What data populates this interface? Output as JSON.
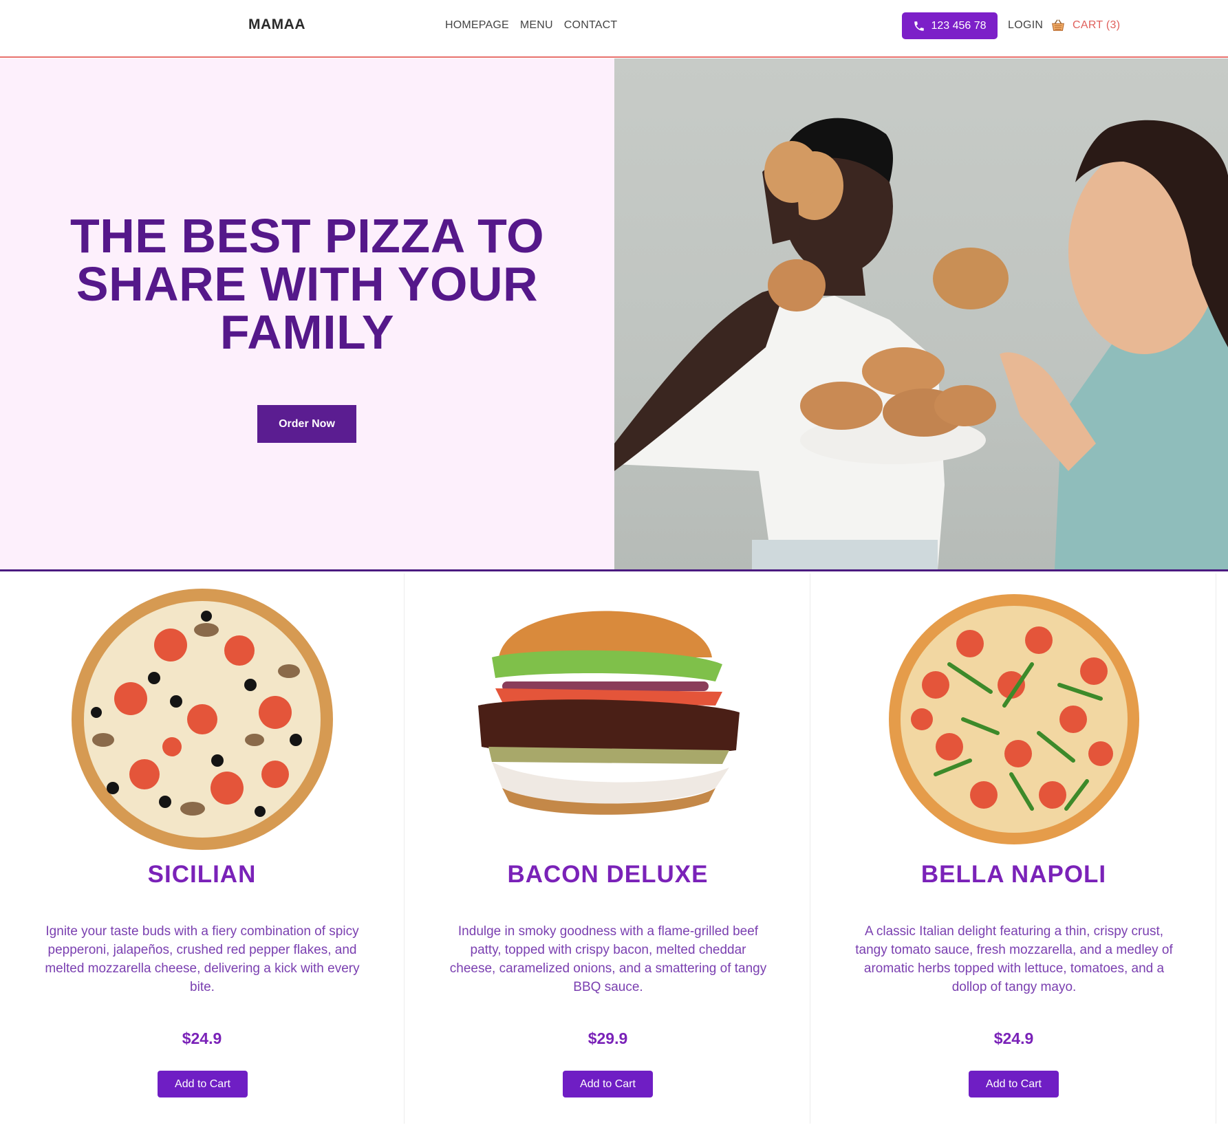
{
  "header": {
    "logo": "MAMAA",
    "nav": [
      "HOMEPAGE",
      "MENU",
      "CONTACT"
    ],
    "phone": "123 456 78",
    "login": "LOGIN",
    "cart": "CART (3)"
  },
  "hero": {
    "title": "THE BEST PIZZA TO SHARE WITH YOUR FAMILY",
    "cta": "Order Now"
  },
  "products": [
    {
      "name": "SICILIAN",
      "description": "Ignite your taste buds with a fiery combination of spicy pepperoni, jalapeños, crushed red pepper flakes, and melted mozzarella cheese, delivering a kick with every bite.",
      "price": "$24.9",
      "button": "Add to Cart"
    },
    {
      "name": "BACON DELUXE",
      "description": "Indulge in smoky goodness with a flame-grilled beef patty, topped with crispy bacon, melted cheddar cheese, caramelized onions, and a smattering of tangy BBQ sauce.",
      "price": "$29.9",
      "button": "Add to Cart"
    },
    {
      "name": "BELLA NAPOLI",
      "description": "A classic Italian delight featuring a thin, crispy crust, tangy tomato sauce, fresh mozzarella, and a medley of aromatic herbs topped with lettuce, tomatoes, and a dollop of tangy mayo.",
      "price": "$24.9",
      "button": "Add to Cart"
    }
  ],
  "colors": {
    "brand_purple": "#7c1fc8",
    "hero_title": "#55188a",
    "cart_accent": "#e0605c",
    "hero_bg": "#fdf0fc"
  },
  "icons": [
    "phone-icon",
    "cart-basket-icon"
  ]
}
